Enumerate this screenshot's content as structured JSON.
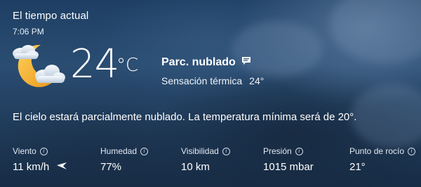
{
  "header": {
    "title": "El tiempo actual",
    "time": "7:06 PM"
  },
  "current": {
    "icon": "partly-cloudy-night-icon",
    "temperature": "24",
    "unit": "°C",
    "condition": "Parc. nublado",
    "feels_like_label": "Sensación térmica",
    "feels_like_value": "24°"
  },
  "summary": "El cielo estará parcialmente nublado. La temperatura mínima será de 20°.",
  "stats": {
    "wind": {
      "label": "Viento",
      "value": "11 km/h"
    },
    "humidity": {
      "label": "Humedad",
      "value": "77%"
    },
    "visibility": {
      "label": "Visibilidad",
      "value": "10 km"
    },
    "pressure": {
      "label": "Presión",
      "value": "1015 mbar"
    },
    "dew_point": {
      "label": "Punto de rocío",
      "value": "21°"
    }
  },
  "colors": {
    "background_top": "#1e3f63",
    "background_bottom": "#172c45",
    "moon": "#f2b12e",
    "cloud": "#e6edf5"
  }
}
